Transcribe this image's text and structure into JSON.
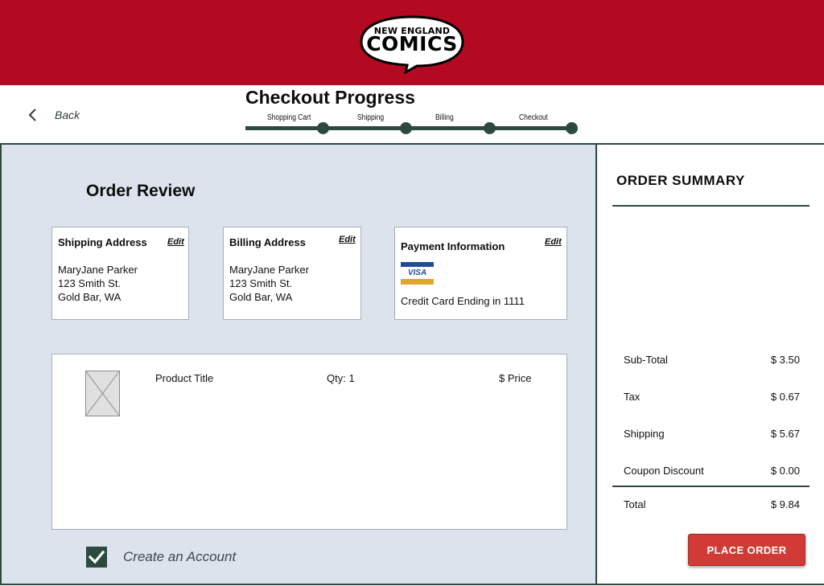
{
  "brand": {
    "logo_line1": "NEW ENGLAND",
    "logo_line2": "COMICS",
    "color": "#b30a21"
  },
  "nav": {
    "back_label": "Back",
    "back_icon": "chevron-left-icon"
  },
  "progress": {
    "title": "Checkout Progress",
    "steps": [
      "Shopping Cart",
      "Shipping",
      "Billing",
      "Checkout"
    ],
    "completed_steps": 4,
    "color": "#2d4a3e"
  },
  "order_review": {
    "title": "Order Review",
    "shipping": {
      "title": "Shipping Address",
      "edit_label": "Edit",
      "name": "MaryJane Parker",
      "street": "123 Smith St.",
      "city": "Gold Bar, WA"
    },
    "billing": {
      "title": "Billing Address",
      "edit_label": "Edit",
      "name": "MaryJane Parker",
      "street": "123 Smith St.",
      "city": "Gold Bar, WA"
    },
    "payment": {
      "title": "Payment Information",
      "edit_label": "Edit",
      "card_brand": "VISA",
      "card_text": "Credit Card Ending in 1111"
    },
    "product": {
      "title": "Product Title",
      "qty": "Qty: 1",
      "price": "$ Price",
      "image_icon": "image-placeholder-icon"
    },
    "create_account": {
      "label": "Create an Account",
      "checked": true
    }
  },
  "summary": {
    "title": "ORDER SUMMARY",
    "rows": [
      {
        "label": "Sub-Total",
        "value": "$ 3.50"
      },
      {
        "label": "Tax",
        "value": "$ 0.67"
      },
      {
        "label": "Shipping",
        "value": "$ 5.67"
      },
      {
        "label": "Coupon Discount",
        "value": "$ 0.00"
      }
    ],
    "total": {
      "label": "Total",
      "value": "$ 9.84"
    },
    "place_order_label": "PLACE ORDER",
    "accent": "#d23b35"
  }
}
